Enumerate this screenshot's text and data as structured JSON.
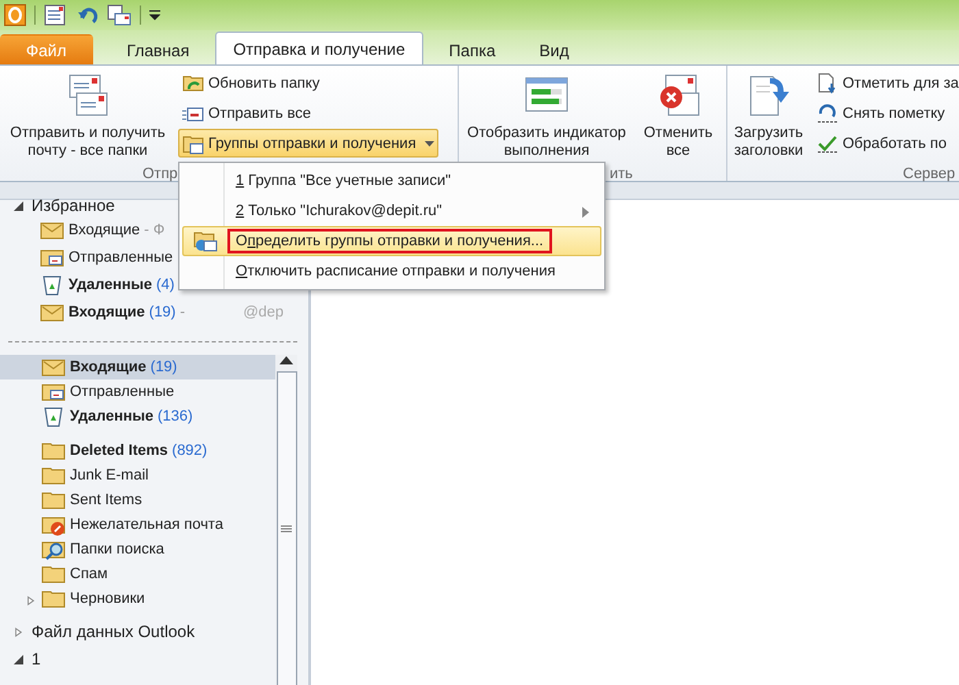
{
  "tabs": [
    {
      "label": "Файл",
      "kind": "file",
      "selected": false
    },
    {
      "label": "Главная",
      "kind": "tab",
      "selected": false
    },
    {
      "label": "Отправка и получение",
      "kind": "tab",
      "selected": true
    },
    {
      "label": "Папка",
      "kind": "tab",
      "selected": false
    },
    {
      "label": "Вид",
      "kind": "tab",
      "selected": false
    }
  ],
  "ribbon": {
    "groups": [
      {
        "label": "Отпр",
        "items": [
          {
            "kind": "large",
            "label": "Отправить и получить почту - все папки"
          },
          {
            "kind": "stack",
            "buttons": [
              {
                "label": "Обновить папку",
                "expanded": false
              },
              {
                "label": "Отправить все",
                "expanded": false
              },
              {
                "label": "Группы отправки и получения",
                "expanded": true
              }
            ]
          }
        ]
      },
      {
        "label": "ить",
        "items": [
          {
            "kind": "large",
            "label": "Отобразить индикатор выполнения"
          },
          {
            "kind": "large",
            "label": "Отменить все"
          }
        ]
      },
      {
        "label": "Сервер",
        "items": [
          {
            "kind": "large",
            "label": "Загрузить заголовки"
          },
          {
            "kind": "stack",
            "buttons": [
              {
                "label": "Отметить для за",
                "expanded": false
              },
              {
                "label": "Снять пометку",
                "expanded": false
              },
              {
                "label": "Обработать по",
                "expanded": false
              }
            ]
          }
        ]
      }
    ]
  },
  "menu": {
    "items": [
      {
        "key": "1",
        "post": " Группа \"Все учетные записи\"",
        "submenu": false,
        "highlighted": false,
        "outlined": false,
        "icon": false
      },
      {
        "key": "2",
        "post": " Только \"Ichurakov@depit.ru\"",
        "submenu": true,
        "highlighted": false,
        "outlined": false,
        "icon": false
      },
      {
        "pre": "О",
        "key": "п",
        "post": "ределить группы отправки и получения...",
        "submenu": false,
        "highlighted": true,
        "outlined": true,
        "icon": true
      },
      {
        "key": "О",
        "post": "тключить расписание отправки и получения",
        "submenu": false,
        "highlighted": false,
        "outlined": false,
        "icon": false
      }
    ]
  },
  "favorites": {
    "label": "Избранное",
    "expanded": true,
    "items": [
      {
        "kind": "inbox",
        "name": "Входящие",
        "suffix": "- Ф",
        "bold": false,
        "selected": false
      },
      {
        "kind": "sent",
        "name": "Отправленные",
        "bold": false,
        "selected": false
      },
      {
        "kind": "trash",
        "name": "Удаленные",
        "count": "(4)",
        "bold": true,
        "selected": false
      },
      {
        "kind": "inbox",
        "name": "Входящие",
        "count": "(19)",
        "suffix": "-",
        "far": "@dep",
        "bold": true,
        "selected": false
      }
    ]
  },
  "folders": [
    {
      "kind": "inbox",
      "name": "Входящие",
      "count": "(19)",
      "bold": true,
      "selected": true
    },
    {
      "kind": "sent",
      "name": "Отправленные",
      "bold": false,
      "selected": false
    },
    {
      "kind": "trash",
      "name": "Удаленные",
      "count": "(136)",
      "bold": true,
      "selected": false
    },
    {
      "kind": "gap"
    },
    {
      "kind": "folder",
      "name": "Deleted Items",
      "count": "(892)",
      "bold": true,
      "selected": false
    },
    {
      "kind": "folder",
      "name": "Junk E-mail",
      "bold": false,
      "selected": false
    },
    {
      "kind": "folder",
      "name": "Sent Items",
      "bold": false,
      "selected": false
    },
    {
      "kind": "junk",
      "name": "Нежелательная почта",
      "bold": false,
      "selected": false
    },
    {
      "kind": "search",
      "name": "Папки поиска",
      "bold": false,
      "selected": false
    },
    {
      "kind": "folder",
      "name": "Спам",
      "bold": false,
      "selected": false
    },
    {
      "kind": "folder",
      "name": "Черновики",
      "bold": false,
      "selected": false,
      "expanded": false
    }
  ],
  "stores": [
    {
      "name": "Файл данных Outlook",
      "expanded": false
    },
    {
      "name": "1",
      "expanded": true
    }
  ]
}
